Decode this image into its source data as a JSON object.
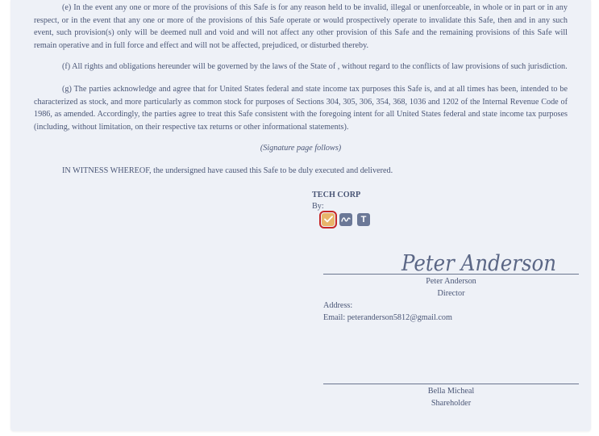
{
  "document": {
    "paragraph_e": "(e) In the event any one or more of the provisions of this Safe is for any reason held to be invalid, illegal or unenforceable, in whole or in part or in any respect, or in the event that any one or more of the provisions of this Safe operate or would prospectively operate to invalidate this Safe, then and in any such event, such provision(s) only will be deemed null and void and will not affect any other provision of this Safe and the remaining provisions of this Safe will remain operative and in full force and effect and will not be affected, prejudiced, or disturbed thereby.",
    "paragraph_f": "(f) All rights and obligations hereunder will be governed by the laws of the State of , without regard to the conflicts of law provisions of such jurisdiction.",
    "paragraph_g": "(g) The parties acknowledge and agree that for United States federal and state income tax purposes this Safe is, and at all times has been, intended to be characterized as stock, and more particularly as common stock for purposes of Sections 304, 305, 306, 354, 368, 1036 and 1202 of the Internal Revenue Code of 1986, as amended. Accordingly, the parties agree to treat this Safe consistent with the foregoing intent for all United States federal and state income tax purposes (including, without limitation, on their respective tax returns or other informational statements).",
    "signature_follows": "(Signature page follows)",
    "witness": "IN WITNESS WHEREOF, the undersigned have caused this Safe to be duly executed and delivered."
  },
  "company_block": {
    "company_name": "TECH CORP",
    "by_label": "By:",
    "tools": {
      "check_icon": "check-icon",
      "draw_icon": "signature-draw-icon",
      "text_icon": "text-tool-icon",
      "text_glyph": "T"
    },
    "signature_image_text": "Peter Anderson",
    "signer_name": "Peter Anderson",
    "signer_title": "Director",
    "address_label": "Address:",
    "email_line": "Email: peteranderson5812@gmail.com"
  },
  "shareholder_block": {
    "signer_name": "Bella Micheal",
    "signer_title": "Shareholder"
  },
  "colors": {
    "page_background": "#eef1f7",
    "text": "#4a5676",
    "check_tool": "#e8b56a",
    "selected_outline": "#c62828",
    "tool_gray": "#6b7897"
  }
}
